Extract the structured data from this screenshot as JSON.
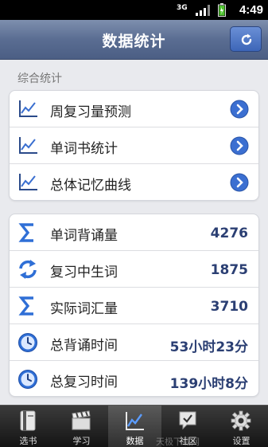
{
  "status": {
    "network": "3G",
    "time": "4:49"
  },
  "header": {
    "title": "数据统计",
    "refresh_icon": "refresh-icon"
  },
  "section": {
    "label": "综合统计"
  },
  "nav_items": [
    {
      "label": "周复习量预测",
      "icon": "line-chart-icon"
    },
    {
      "label": "单词书统计",
      "icon": "line-chart-icon"
    },
    {
      "label": "总体记忆曲线",
      "icon": "line-chart-icon"
    }
  ],
  "stats": [
    {
      "label": "单词背诵量",
      "icon": "sigma-icon",
      "value": "4276"
    },
    {
      "label": "复习中生词",
      "icon": "sync-icon",
      "value": "1875"
    },
    {
      "label": "实际词汇量",
      "icon": "sigma-icon",
      "value": "3710"
    },
    {
      "label": "总背诵时间",
      "icon": "clock-icon",
      "value": "53小时23分"
    },
    {
      "label": "总复习时间",
      "icon": "clock-icon",
      "value": "139小时8分"
    }
  ],
  "tabs": [
    {
      "label": "选书",
      "icon": "book-icon",
      "active": false
    },
    {
      "label": "学习",
      "icon": "clapperboard-icon",
      "active": false
    },
    {
      "label": "数据",
      "icon": "line-chart-icon",
      "active": true
    },
    {
      "label": "社区",
      "icon": "chat-icon",
      "active": false
    },
    {
      "label": "设置",
      "icon": "gear-icon",
      "active": false
    }
  ],
  "watermark": "天极下载网",
  "colors": {
    "titlebar": "#5a6d92",
    "value_text": "#2b3f73",
    "arrow_blue": "#3b6fd1",
    "background": "#e9eaee"
  }
}
